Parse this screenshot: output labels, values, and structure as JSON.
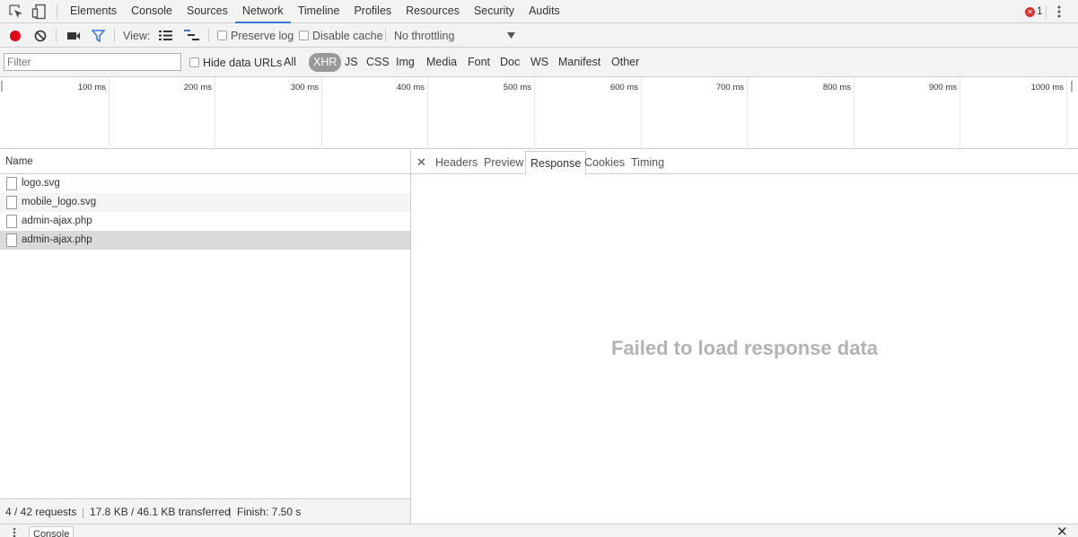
{
  "top_tabs": [
    "Elements",
    "Console",
    "Sources",
    "Network",
    "Timeline",
    "Profiles",
    "Resources",
    "Security",
    "Audits"
  ],
  "active_tab": "Network",
  "error_count": "1",
  "toolbar": {
    "view_label": "View:",
    "preserve_log": "Preserve log",
    "disable_cache": "Disable cache",
    "throttling": "No throttling"
  },
  "filter": {
    "placeholder": "Filter",
    "hide_data_urls": "Hide data URLs",
    "types": [
      "All",
      "XHR",
      "JS",
      "CSS",
      "Img",
      "Media",
      "Font",
      "Doc",
      "WS",
      "Manifest",
      "Other"
    ],
    "active_type": "XHR"
  },
  "overview": {
    "ticks": [
      "100 ms",
      "200 ms",
      "300 ms",
      "400 ms",
      "500 ms",
      "600 ms",
      "700 ms",
      "800 ms",
      "900 ms",
      "1000 ms"
    ]
  },
  "requests": {
    "column_name": "Name",
    "rows": [
      "logo.svg",
      "mobile_logo.svg",
      "admin-ajax.php",
      "admin-ajax.php"
    ],
    "selected_index": 3
  },
  "status": {
    "requests": "4 / 42 requests",
    "transferred": "17.8 KB / 46.1 KB transferred",
    "finish": "Finish: 7.50 s"
  },
  "detail": {
    "tabs": [
      "Headers",
      "Preview",
      "Response",
      "Cookies",
      "Timing"
    ],
    "active_tab": "Response",
    "message": "Failed to load response data"
  },
  "drawer": {
    "console_tab": "Console"
  },
  "colors": {
    "record": "#e0001a",
    "accent": "#3879d9",
    "error": "#d9302c"
  }
}
